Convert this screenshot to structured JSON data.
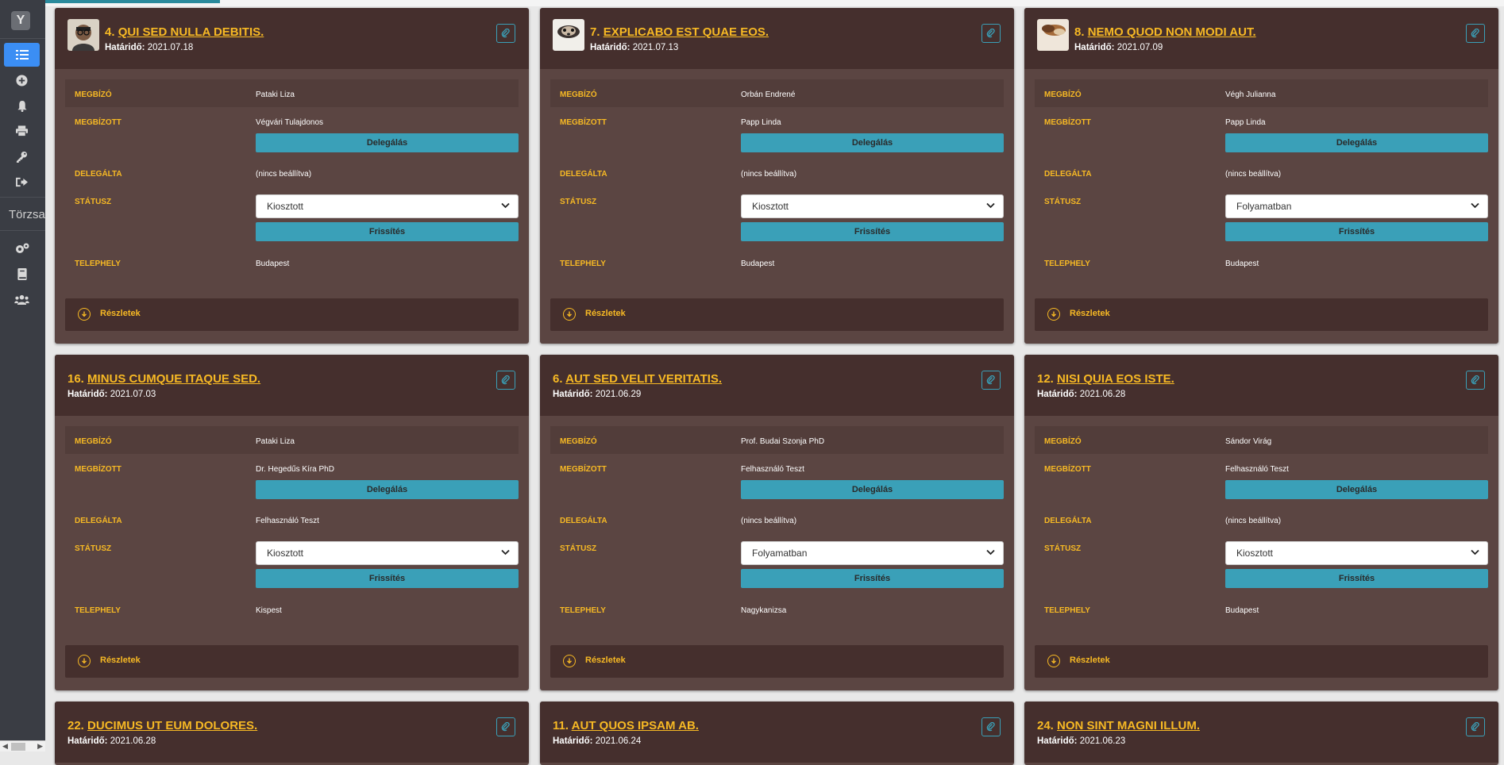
{
  "sidebar": {
    "logo": "Y",
    "items": [
      {
        "icon": "list-icon",
        "active": true
      },
      {
        "icon": "plus-circle-icon",
        "active": false
      },
      {
        "icon": "bell-icon",
        "active": false
      },
      {
        "icon": "print-icon",
        "active": false
      },
      {
        "icon": "key-icon",
        "active": false
      },
      {
        "icon": "sign-out-icon",
        "active": false
      }
    ],
    "section_text": "Törzsadatok",
    "items2": [
      {
        "icon": "cogs-icon"
      },
      {
        "icon": "book-icon"
      },
      {
        "icon": "users-icon"
      }
    ]
  },
  "labels": {
    "megbizo": "MEGBÍZÓ",
    "megbizott": "MEGBÍZOTT",
    "delegalta": "DELEGÁLTA",
    "statusz": "STÁTUSZ",
    "telephely": "TELEPHELY",
    "delegalas_btn": "Delegálás",
    "frissites_btn": "Frissítés",
    "reszletek": "Részletek",
    "hatarido": "Határidő:"
  },
  "cards": [
    {
      "num": "4.",
      "title": "QUI SED NULLA DEBITIS.",
      "deadline": "2021.07.18",
      "megbizo": "Pataki Liza",
      "megbizott": "Végvári Tulajdonos",
      "delegalta": "(nincs beállítva)",
      "status": "Kiosztott",
      "telephely": "Budapest",
      "avatar": true
    },
    {
      "num": "7.",
      "title": "EXPLICABO EST QUAE EOS.",
      "deadline": "2021.07.13",
      "megbizo": "Orbán Endrené",
      "megbizott": "Papp Linda",
      "delegalta": "(nincs beállítva)",
      "status": "Kiosztott",
      "telephely": "Budapest",
      "avatar": true
    },
    {
      "num": "8.",
      "title": "NEMO QUOD NON MODI AUT.",
      "deadline": "2021.07.09",
      "megbizo": "Végh Julianna",
      "megbizott": "Papp Linda",
      "delegalta": "(nincs beállítva)",
      "status": "Folyamatban",
      "telephely": "Budapest",
      "avatar": true
    },
    {
      "num": "16.",
      "title": "MINUS CUMQUE ITAQUE SED.",
      "deadline": "2021.07.03",
      "megbizo": "Pataki Liza",
      "megbizott": "Dr. Hegedűs Kíra PhD",
      "delegalta": "Felhasználó Teszt",
      "status": "Kiosztott",
      "telephely": "Kispest",
      "avatar": false
    },
    {
      "num": "6.",
      "title": "AUT SED VELIT VERITATIS.",
      "deadline": "2021.06.29",
      "megbizo": "Prof. Budai Szonja PhD",
      "megbizott": "Felhasználó Teszt",
      "delegalta": "(nincs beállítva)",
      "status": "Folyamatban",
      "telephely": "Nagykanizsa",
      "avatar": false
    },
    {
      "num": "12.",
      "title": "NISI QUIA EOS ISTE.",
      "deadline": "2021.06.28",
      "megbizo": "Sándor Virág",
      "megbizott": "Felhasználó Teszt",
      "delegalta": "(nincs beállítva)",
      "status": "Kiosztott",
      "telephely": "Budapest",
      "avatar": false
    },
    {
      "num": "22.",
      "title": "DUCIMUS UT EUM DOLORES.",
      "deadline": "2021.06.28",
      "avatar": false
    },
    {
      "num": "11.",
      "title": "AUT QUOS IPSAM AB.",
      "deadline": "2021.06.24",
      "avatar": false
    },
    {
      "num": "24.",
      "title": "NON SINT MAGNI ILLUM.",
      "deadline": "2021.06.23",
      "avatar": false
    }
  ]
}
